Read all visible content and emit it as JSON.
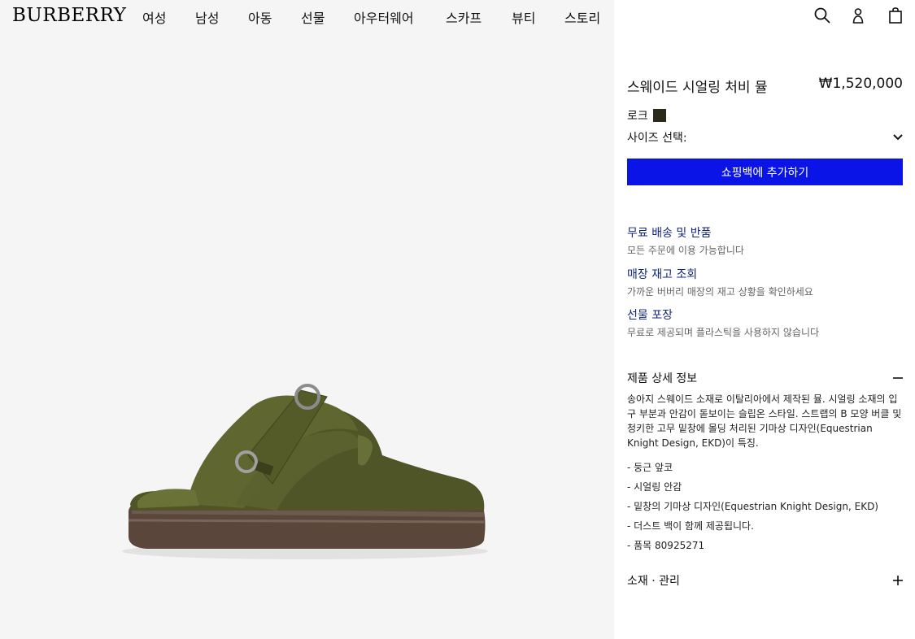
{
  "header": {
    "logo": "BURBERRY",
    "nav": [
      "여성",
      "남성",
      "아동",
      "선물",
      "아우터웨어",
      "스카프",
      "뷰티",
      "스토리"
    ],
    "icons": [
      "search-icon",
      "account-icon",
      "shopping-bag-icon"
    ]
  },
  "product": {
    "title": "스웨이드 시얼링 처비 뮬",
    "price": "₩1,520,000",
    "color_label": "로크",
    "color_hex": "#2b2a1a",
    "size_label": "사이즈 선택:",
    "add_to_bag": "쇼핑백에 추가하기",
    "cta_color": "#0a14e6"
  },
  "services": [
    {
      "title": "무료 배송 및 반품",
      "sub": "모든 주문에 이용 가능합니다"
    },
    {
      "title": "매장 재고 조회",
      "sub": "가까운 버버리 매장의 재고 상황을 확인하세요"
    },
    {
      "title": "선물 포장",
      "sub": "무료로 제공되며 플라스틱을 사용하지 않습니다"
    }
  ],
  "details": {
    "title": "제품 상세 정보",
    "description": "송아지 스웨이드 소재로 이탈리아에서 제작된 뮬. 시얼링 소재의 입구 부분과 안감이 돋보이는 슬립온 스타일. 스트랩의 B 모양 버클 및 청키한 고무 밑창에 몰딩 처리된 기마상 디자인(Equestrian Knight Design, EKD)이 특징.",
    "bullets": [
      "- 둥근 앞코",
      "- 시얼링 안감",
      "- 밑창의 기마상 디자인(Equestrian Knight Design, EKD)",
      "- 더스트 백이 함께 제공됩니다.",
      "- 품목 80925271"
    ]
  },
  "materials": {
    "title": "소재 · 관리"
  }
}
